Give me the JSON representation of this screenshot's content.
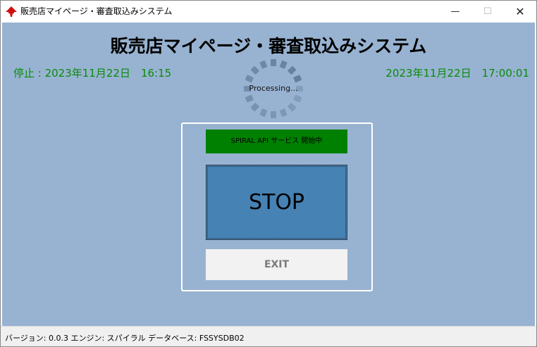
{
  "window": {
    "title": "販売店マイページ・審査取込みシステム",
    "controls": {
      "minimize": "—",
      "maximize": "☐",
      "close": "✕"
    }
  },
  "main": {
    "title": "販売店マイページ・審査取込みシステム",
    "status_left": "停止 : 2023年11月22日　16:15",
    "clock_right": "2023年11月22日　17:00:01",
    "processing_label": "Processing...",
    "service_badge": "SPIRAL API サービス 開始中",
    "stop_button": "STOP",
    "exit_button": "EXIT"
  },
  "statusbar": {
    "text": "バージョン: 0.0.3 エンジン: スパイラル データベース: FSSYSDB02"
  },
  "colors": {
    "background": "#98b3d1",
    "status_green": "#0a8a0a",
    "badge_green": "#008000",
    "stop_blue": "#4682b4",
    "exit_gray": "#f2f2f2"
  },
  "icons": {
    "app": "red-tree-logo-icon",
    "spinner": "loading-spinner-icon"
  }
}
